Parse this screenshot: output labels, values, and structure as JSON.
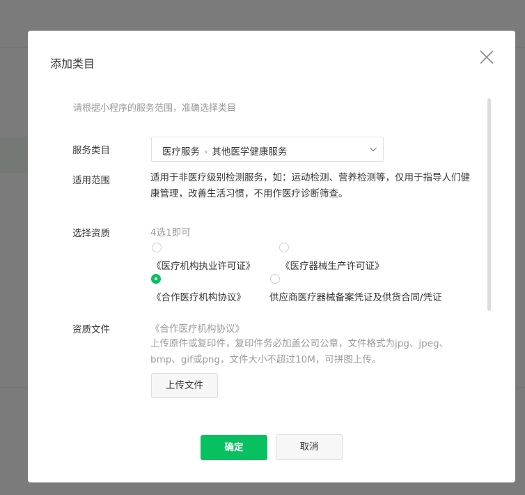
{
  "dialog": {
    "title": "添加类目",
    "tip": "请根据小程序的服务范围，准确选择类目"
  },
  "service_category": {
    "label": "服务类目",
    "level1": "医疗服务",
    "level2": "其他医学健康服务"
  },
  "scope": {
    "label": "适用范围",
    "text": "适用于非医疗级别检测服务，如：运动检测、营养检测等，仅用于指导人们健康管理，改善生活习惯，不用作医疗诊断筛查。"
  },
  "qualification": {
    "label": "选择资质",
    "hint": "4选1即可",
    "options": [
      {
        "label": "《医疗机构执业许可证》",
        "checked": false
      },
      {
        "label": "《医疗器械生产许可证》",
        "checked": false
      },
      {
        "label": "《合作医疗机构协议》",
        "checked": true
      },
      {
        "label": "供应商医疗器械备案凭证及供货合同/凭证",
        "checked": false
      }
    ]
  },
  "files": {
    "label": "资质文件",
    "file_name": "《合作医疗机构协议》",
    "description": "上传原件或复印件，复印件务必加盖公司公章，文件格式为jpg、jpeg、bmp、gif或png，文件大小不超过10M，可拼图上传。",
    "upload_label": "上传文件"
  },
  "footer": {
    "confirm_label": "确定",
    "cancel_label": "取消"
  },
  "colors": {
    "accent": "#07c160",
    "overlay": "rgba(0,0,0,0.5)"
  },
  "icons": {
    "close": "close-icon",
    "select_arrow": "chevron-down-icon",
    "breadcrumb_sep": "chevron-right-icon"
  }
}
